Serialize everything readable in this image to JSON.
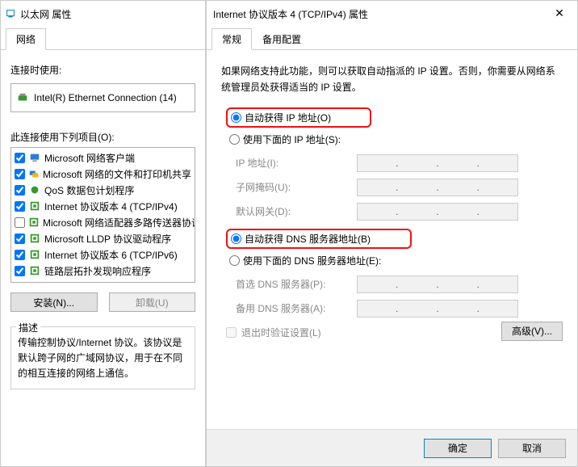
{
  "left": {
    "title": "以太网 属性",
    "tab_network": "网络",
    "connect_using_label": "连接时使用:",
    "adapter_name": "Intel(R) Ethernet Connection (14)",
    "items_label": "此连接使用下列项目(O):",
    "items": [
      {
        "checked": true,
        "icon": "client",
        "label": "Microsoft 网络客户端"
      },
      {
        "checked": true,
        "icon": "fps",
        "label": "Microsoft 网络的文件和打印机共享"
      },
      {
        "checked": true,
        "icon": "qos",
        "label": "QoS 数据包计划程序"
      },
      {
        "checked": true,
        "icon": "proto",
        "label": "Internet 协议版本 4 (TCP/IPv4)"
      },
      {
        "checked": false,
        "icon": "proto",
        "label": "Microsoft 网络适配器多路传送器协议"
      },
      {
        "checked": true,
        "icon": "proto",
        "label": "Microsoft LLDP 协议驱动程序"
      },
      {
        "checked": true,
        "icon": "proto",
        "label": "Internet 协议版本 6 (TCP/IPv6)"
      },
      {
        "checked": true,
        "icon": "proto",
        "label": "链路层拓扑发现响应程序"
      }
    ],
    "install_btn": "安装(N)...",
    "uninstall_btn": "卸载(U)",
    "desc_title": "描述",
    "desc_text": "传输控制协议/Internet 协议。该协议是默认跨子网的广域网协议，用于在不同的相互连接的网络上通信。"
  },
  "right": {
    "title": "Internet 协议版本 4 (TCP/IPv4) 属性",
    "tab_general": "常规",
    "tab_alt": "备用配置",
    "intro": "如果网络支持此功能，则可以获取自动指派的 IP 设置。否则，你需要从网络系统管理员处获得适当的 IP 设置。",
    "ip_auto": "自动获得 IP 地址(O)",
    "ip_manual": "使用下面的 IP 地址(S):",
    "ip_addr_label": "IP 地址(I):",
    "subnet_label": "子网掩码(U):",
    "gateway_label": "默认网关(D):",
    "dns_auto": "自动获得 DNS 服务器地址(B)",
    "dns_manual": "使用下面的 DNS 服务器地址(E):",
    "pref_dns_label": "首选 DNS 服务器(P):",
    "alt_dns_label": "备用 DNS 服务器(A):",
    "exit_validate": "退出时验证设置(L)",
    "advanced_btn": "高级(V)...",
    "ok_btn": "确定",
    "cancel_btn": "取消"
  }
}
